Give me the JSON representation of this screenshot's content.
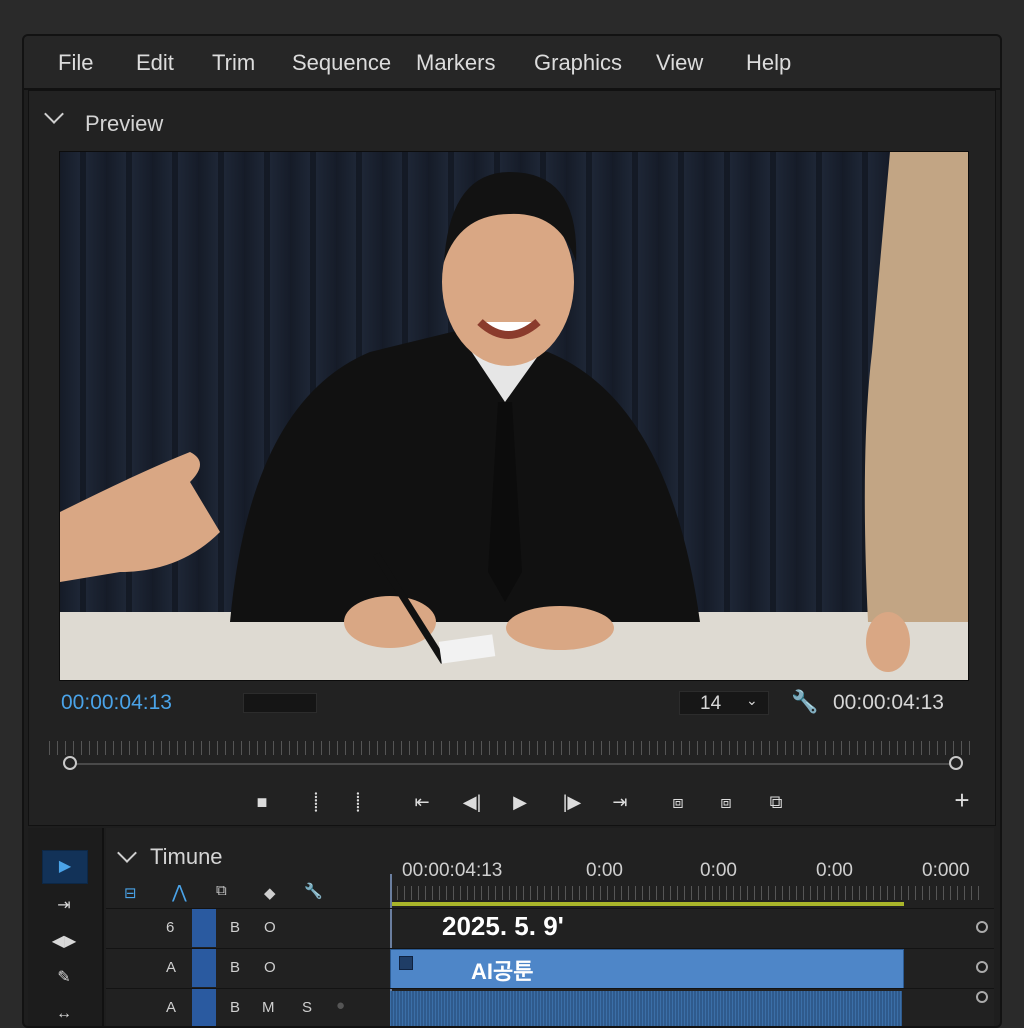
{
  "menu": [
    "File",
    "Edit",
    "Trim",
    "Sequence",
    "Markers",
    "Graphics",
    "View",
    "Help"
  ],
  "preview": {
    "title": "Preview",
    "timecode_left": "00:00:04:13",
    "zoom_value": "14",
    "timecode_right": "00:00:04:13"
  },
  "timeline": {
    "title": "Timune",
    "ruler": [
      "00:00:04:13",
      "0:00",
      "0:00",
      "0:00",
      "0:000"
    ],
    "text_clip": "2025. 5. 9'",
    "ai_clip": "AI공툰",
    "tracks": [
      {
        "label": "6",
        "btn1": "B",
        "btn2": "O"
      },
      {
        "label": "A",
        "btn1": "B",
        "btn2": "O"
      },
      {
        "label": "A",
        "btn1": "B",
        "btn2": "M",
        "btn3": "S"
      }
    ]
  },
  "colors": {
    "accent": "#4aa3e8",
    "clip_blue": "#4e86c8",
    "playhead_bar": "#a9b52a"
  }
}
